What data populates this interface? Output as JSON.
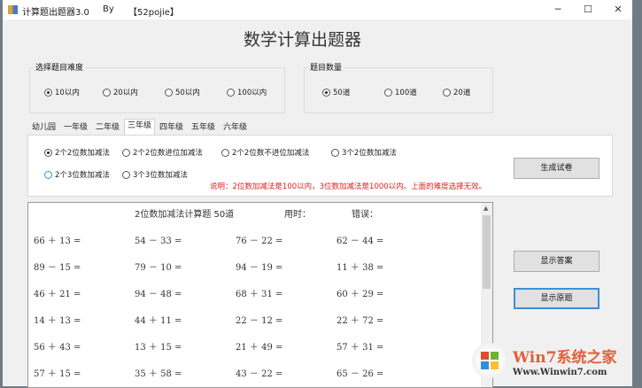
{
  "window": {
    "title": "计算题出题器3.0",
    "by": "By",
    "author": "【52pojie】",
    "minimize": "─",
    "maximize": "☐",
    "close": "✕"
  },
  "heading": "数学计算出题器",
  "difficulty": {
    "label": "选择题目难度",
    "options": [
      "10以内",
      "20以内",
      "50以内",
      "100以内"
    ],
    "selected": 0
  },
  "count": {
    "label": "题目数量",
    "options": [
      "50道",
      "100道",
      "20道"
    ],
    "selected": 0
  },
  "tabs": [
    "幼儿园",
    "一年级",
    "二年级",
    "三年级",
    "四年级",
    "五年级",
    "六年级"
  ],
  "active_tab": 3,
  "types": [
    "2个2位数加减法",
    "2个2位数进位加减法",
    "2个2位数不进位加减法",
    "3个2位数加减法",
    "2个3位数加减法",
    "3个3位数加减法"
  ],
  "note": "说明：2位数加减法是100以内，3位数加减法是1000以内。上面的难度选择无效。",
  "buttons": {
    "generate": "生成试卷",
    "show_answers": "显示答案",
    "show_original": "显示原题"
  },
  "sheet": {
    "title": "2位数加减法计算题 50道",
    "time_label": "用时：",
    "errors_label": "错误：",
    "problems": [
      [
        "66 ＋ 13 =",
        "54 － 33 =",
        "76 － 22 =",
        "62 － 44 ="
      ],
      [
        "89 － 15 =",
        "79 － 10 =",
        "94 － 19 =",
        "11 ＋ 38 ="
      ],
      [
        "46 ＋ 21 =",
        "94 － 48 =",
        "68 ＋ 31 =",
        "60 ＋ 29 ="
      ],
      [
        "14 ＋ 13 =",
        "44 ＋ 11 =",
        "22 － 12 =",
        "22 ＋ 72 ="
      ],
      [
        "56 ＋ 43 =",
        "13 ＋ 15 =",
        "21 ＋ 49 =",
        "57 ＋ 31 ="
      ],
      [
        "57 ＋ 15 =",
        "35 ＋ 58 =",
        "43 － 22 =",
        "65 － 26 ="
      ]
    ]
  },
  "watermark": {
    "brand": "Win7系统之家",
    "url": "Www.Winwin7.com"
  },
  "colors": {
    "note": "#e02020",
    "focus": "#3d8fd6"
  }
}
